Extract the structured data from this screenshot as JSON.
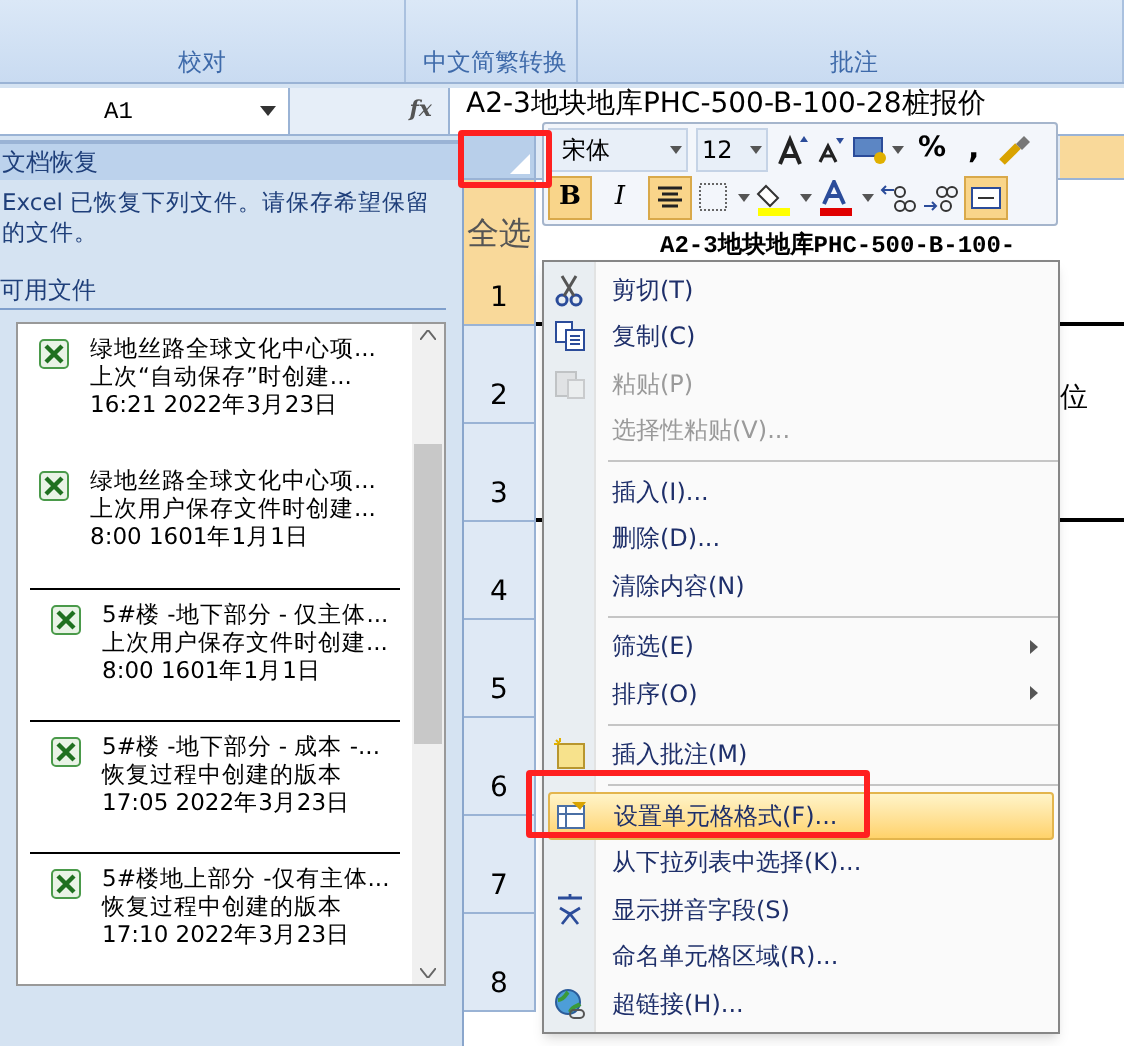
{
  "ribbon": {
    "groups": [
      {
        "label": "校对"
      },
      {
        "label": "中文简繁转换"
      },
      {
        "label": "批注"
      }
    ]
  },
  "formula_bar": {
    "name_box": "A1",
    "function_label": "fx",
    "formula": "A2-3地块地库PHC-500-B-100-28桩报价"
  },
  "recovery_pane": {
    "title": "文档恢复",
    "message": "Excel 已恢复下列文件。请保存希望保留的文件。",
    "section": "可用文件",
    "files": [
      {
        "name": "绿地丝路全球文化中心项...",
        "source": "上次“自动保存”时创建...",
        "time": "16:21 2022年3月23日"
      },
      {
        "name": "绿地丝路全球文化中心项...",
        "source": "上次用户保存文件时创建...",
        "time": "8:00 1601年1月1日"
      },
      {
        "name": "5#楼 -地下部分 - 仅主体...",
        "source": "上次用户保存文件时创建...",
        "time": "8:00 1601年1月1日"
      },
      {
        "name": "5#楼 -地下部分 - 成本 -...",
        "source": "恢复过程中创建的版本",
        "time": "17:05 2022年3月23日"
      },
      {
        "name": "5#楼地上部分 -仅有主体...",
        "source": "恢复过程中创建的版本",
        "time": "17:10 2022年3月23日"
      }
    ]
  },
  "sheet": {
    "select_all": "全选",
    "rows": [
      {
        "label": "1",
        "selected": true
      },
      {
        "label": "2",
        "selected": false
      },
      {
        "label": "3",
        "selected": false
      },
      {
        "label": "4",
        "selected": false
      },
      {
        "label": "5",
        "selected": false
      },
      {
        "label": "6",
        "selected": false
      },
      {
        "label": "7",
        "selected": false
      },
      {
        "label": "8",
        "selected": false
      }
    ],
    "title_cell": "A2-3地块地库PHC-500-B-100-",
    "side_cell": "位"
  },
  "mini_toolbar": {
    "font": "宋体",
    "size": "12",
    "percent": "%",
    "comma": ",",
    "bold": {
      "label": "B",
      "selected": true
    },
    "italic": {
      "label": "I",
      "selected": false
    },
    "align_center": {
      "selected": true
    },
    "wrap": {
      "selected": true
    }
  },
  "context_menu": {
    "items": [
      {
        "kind": "item",
        "label": "剪切(T)",
        "disabled": false,
        "submenu": false,
        "selected": false
      },
      {
        "kind": "item",
        "label": "复制(C)",
        "disabled": false,
        "submenu": false,
        "selected": false
      },
      {
        "kind": "item",
        "label": "粘贴(P)",
        "disabled": true,
        "submenu": false,
        "selected": false
      },
      {
        "kind": "item",
        "label": "选择性粘贴(V)...",
        "disabled": true,
        "submenu": false,
        "selected": false
      },
      {
        "kind": "separator"
      },
      {
        "kind": "item",
        "label": "插入(I)...",
        "disabled": false,
        "submenu": false,
        "selected": false
      },
      {
        "kind": "item",
        "label": "删除(D)...",
        "disabled": false,
        "submenu": false,
        "selected": false
      },
      {
        "kind": "item",
        "label": "清除内容(N)",
        "disabled": false,
        "submenu": false,
        "selected": false
      },
      {
        "kind": "separator"
      },
      {
        "kind": "item",
        "label": "筛选(E)",
        "disabled": false,
        "submenu": true,
        "selected": false
      },
      {
        "kind": "item",
        "label": "排序(O)",
        "disabled": false,
        "submenu": true,
        "selected": false
      },
      {
        "kind": "separator"
      },
      {
        "kind": "item",
        "label": "插入批注(M)",
        "disabled": false,
        "submenu": false,
        "selected": false
      },
      {
        "kind": "separator"
      },
      {
        "kind": "item",
        "label": "设置单元格格式(F)...",
        "disabled": false,
        "submenu": false,
        "selected": true
      },
      {
        "kind": "item",
        "label": "从下拉列表中选择(K)...",
        "disabled": false,
        "submenu": false,
        "selected": false
      },
      {
        "kind": "item",
        "label": "显示拼音字段(S)",
        "disabled": false,
        "submenu": false,
        "selected": false
      },
      {
        "kind": "item",
        "label": "命名单元格区域(R)...",
        "disabled": false,
        "submenu": false,
        "selected": false
      },
      {
        "kind": "item",
        "label": "超链接(H)...",
        "disabled": false,
        "submenu": false,
        "selected": false
      }
    ]
  },
  "annotations": [
    {
      "kind": "highlight-box"
    },
    {
      "kind": "highlight-box"
    }
  ]
}
